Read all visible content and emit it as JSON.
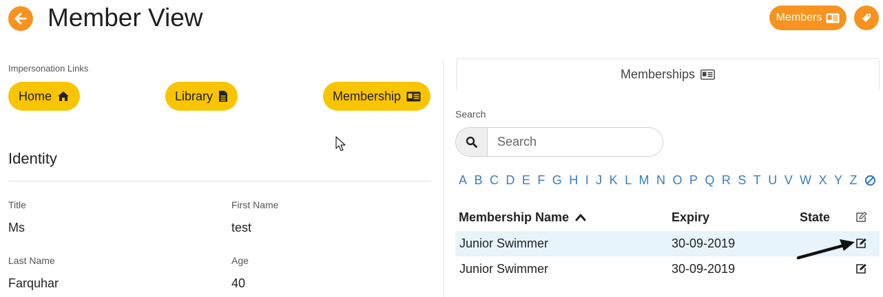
{
  "header": {
    "title": "Member View",
    "back_icon": "arrow-left-icon",
    "members_label": "Members",
    "members_icon": "id-card-icon",
    "tag_icon": "tag-icon"
  },
  "impersonation": {
    "label": "Impersonation Links",
    "buttons": [
      {
        "label": "Home",
        "icon": "home-icon"
      },
      {
        "label": "Library",
        "icon": "file-icon"
      },
      {
        "label": "Membership",
        "icon": "id-card-icon"
      }
    ]
  },
  "identity": {
    "heading": "Identity",
    "fields": [
      {
        "label": "Title",
        "value": "Ms"
      },
      {
        "label": "First Name",
        "value": "test"
      },
      {
        "label": "Last Name",
        "value": "Farquhar"
      },
      {
        "label": "Age",
        "value": "40"
      }
    ]
  },
  "memberships": {
    "tab_label": "Memberships",
    "search_label": "Search",
    "search_placeholder": "Search",
    "search_value": "",
    "alphabet": [
      "A",
      "B",
      "C",
      "D",
      "E",
      "F",
      "G",
      "H",
      "I",
      "J",
      "K",
      "L",
      "M",
      "N",
      "O",
      "P",
      "Q",
      "R",
      "S",
      "T",
      "U",
      "V",
      "W",
      "X",
      "Y",
      "Z"
    ],
    "columns": [
      "Membership Name",
      "Expiry",
      "State"
    ],
    "rows": [
      {
        "name": "Junior Swimmer",
        "expiry": "30-09-2019",
        "state": ""
      },
      {
        "name": "Junior Swimmer",
        "expiry": "30-09-2019",
        "state": ""
      }
    ]
  },
  "colors": {
    "orange": "#f7931e",
    "yellow": "#f9c400",
    "link_blue": "#3a7dc0",
    "row_highlight": "#e8f4fc"
  }
}
